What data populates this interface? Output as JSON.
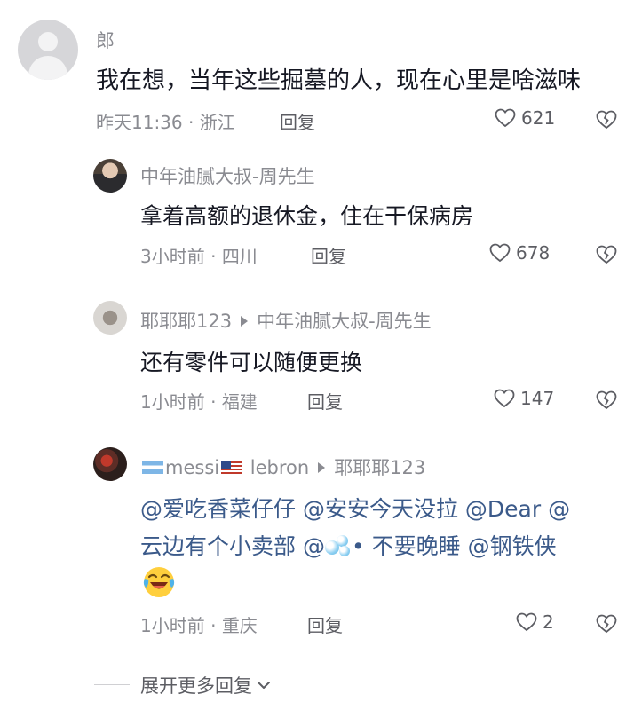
{
  "comments": [
    {
      "username": "郎",
      "content": "我在想，当年这些掘墓的人，现在心里是啥滋味",
      "time": "昨天11:36",
      "location": "浙江",
      "reply_label": "回复",
      "likes": "621"
    },
    {
      "username": "中年油腻大叔-周先生",
      "content": "拿着高额的退休金，住在干保病房",
      "time": "3小时前",
      "location": "四川",
      "reply_label": "回复",
      "likes": "678"
    },
    {
      "username": "耶耶耶123",
      "reply_to": "中年油腻大叔-周先生",
      "content": "还有零件可以随便更换",
      "time": "1小时前",
      "location": "福建",
      "reply_label": "回复",
      "likes": "147"
    },
    {
      "username_part1": "messi",
      "username_part2": " lebron",
      "reply_to": "耶耶耶123",
      "line1": "@爱吃香菜仔仔 @安安今天没拉 @Dear @",
      "line2_a": "云边有个小卖部 @",
      "line2_b": "• 不要晚睡 @钢铁侠",
      "time": "1小时前",
      "location": "重庆",
      "reply_label": "回复",
      "likes": "2"
    }
  ],
  "separator": " · ",
  "expand_label": "展开更多回复",
  "colors": {
    "text": "#161823",
    "meta": "#8a8b91",
    "mention": "#3b5a8a"
  }
}
